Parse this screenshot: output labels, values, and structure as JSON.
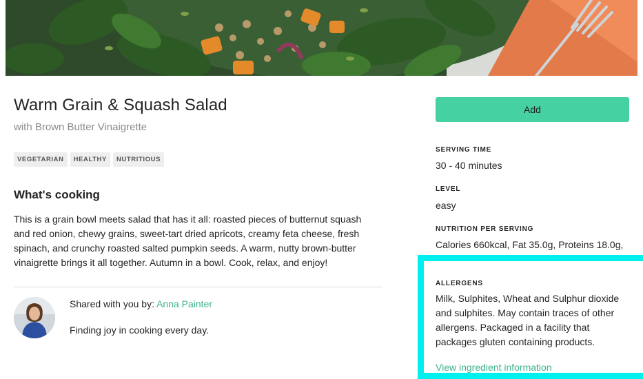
{
  "recipe": {
    "title": "Warm Grain & Squash Salad",
    "subtitle": "with Brown Butter Vinaigrette",
    "tags": [
      "VEGETARIAN",
      "HEALTHY",
      "NUTRITIOUS"
    ],
    "section_heading": "What's cooking",
    "description": "This is a grain bowl meets salad that has it all: roasted pieces of butternut squash and red onion, chewy grains, sweet-tart dried apricots, creamy feta cheese, fresh spinach, and crunchy roasted salted pumpkin seeds. A warm, nutty brown-butter vinaigrette brings it all together. Autumn in a bowl. Cook, relax, and enjoy!"
  },
  "share": {
    "prefix": "Shared with you by: ",
    "name": "Anna Painter",
    "bio": "Finding joy in cooking every day."
  },
  "sidebar": {
    "add_label": "Add",
    "serving_time_label": "SERVING TIME",
    "serving_time_value": "30 - 40 minutes",
    "level_label": "LEVEL",
    "level_value": "easy",
    "nutrition_label": "NUTRITION PER SERVING",
    "nutrition_value": "Calories 660kcal, Fat 35.0g, Proteins 18.0g,",
    "allergens_label": "ALLERGENS",
    "allergens_text": "Milk, Sulphites, Wheat and Sulphur dioxide and sulphites. May contain traces of other allergens. Packaged in a facility that packages gluten containing products.",
    "ingredient_link": "View ingredient information"
  },
  "colors": {
    "accent": "#45d1a1",
    "link": "#3bb28a",
    "highlight": "#00f0f0"
  },
  "icons": {
    "hero": "salad-photo",
    "avatar": "user-avatar"
  }
}
